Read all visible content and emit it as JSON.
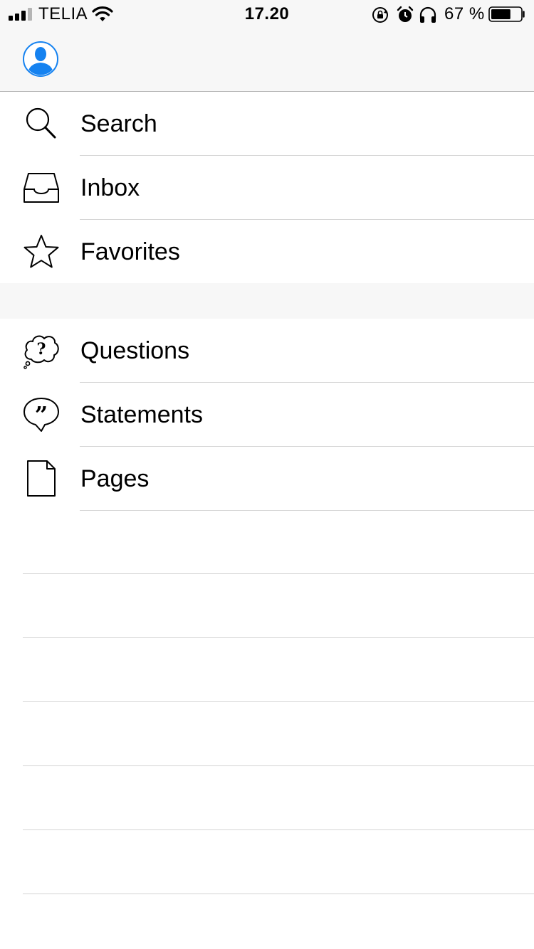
{
  "status_bar": {
    "carrier": "TELIA",
    "time": "17.20",
    "battery_percent": "67 %",
    "battery_level": 0.67
  },
  "colors": {
    "accent": "#1582f0",
    "bar_background": "#f7f7f7",
    "separator": "#d4d4d4"
  },
  "menu": {
    "section1": [
      {
        "label": "Search",
        "icon": "search-icon"
      },
      {
        "label": "Inbox",
        "icon": "inbox-icon"
      },
      {
        "label": "Favorites",
        "icon": "star-icon"
      }
    ],
    "section2": [
      {
        "label": "Questions",
        "icon": "question-bubble-icon"
      },
      {
        "label": "Statements",
        "icon": "quote-bubble-icon"
      },
      {
        "label": "Pages",
        "icon": "page-icon"
      }
    ]
  }
}
